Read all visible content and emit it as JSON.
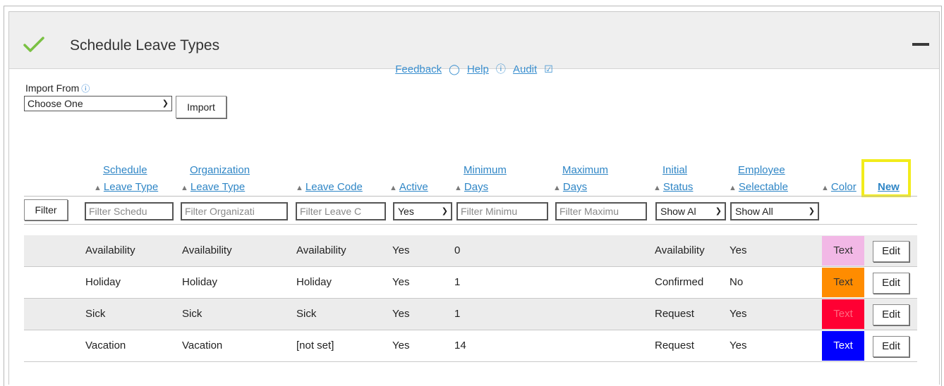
{
  "panel": {
    "title": "Schedule Leave Types"
  },
  "links": {
    "feedback": "Feedback",
    "help": "Help",
    "audit": "Audit"
  },
  "import": {
    "label": "Import From",
    "select_value": "Choose One",
    "button": "Import"
  },
  "columns": {
    "schedule_leave_type": [
      "Schedule",
      "Leave Type"
    ],
    "organization_leave_type": [
      "Organization",
      "Leave Type"
    ],
    "leave_code": "Leave Code",
    "active": "Active",
    "minimum_days": [
      "Minimum",
      "Days"
    ],
    "maximum_days": [
      "Maximum",
      "Days"
    ],
    "initial_status": [
      "Initial",
      "Status"
    ],
    "employee_selectable": [
      "Employee",
      "Selectable"
    ],
    "color": "Color",
    "new": "New"
  },
  "filters": {
    "button": "Filter",
    "schedule_placeholder": "Filter Schedu",
    "organization_placeholder": "Filter Organizati",
    "leave_code_placeholder": "Filter Leave C",
    "active_value": "Yes",
    "minimum_placeholder": "Filter Minimu",
    "maximum_placeholder": "Filter Maximu",
    "status_value": "Show Al",
    "selectable_value": "Show All"
  },
  "rows": [
    {
      "schedule": "Availability",
      "organization": "Availability",
      "code": "Availability",
      "active": "Yes",
      "min": "0",
      "max": "",
      "status": "Availability",
      "selectable": "Yes",
      "color_text": "Text",
      "color_bg": "#f2b8e6",
      "color_fg": "#333333",
      "edit": "Edit"
    },
    {
      "schedule": "Holiday",
      "organization": "Holiday",
      "code": "Holiday",
      "active": "Yes",
      "min": "1",
      "max": "",
      "status": "Confirmed",
      "selectable": "No",
      "color_text": "Text",
      "color_bg": "#ff8c00",
      "color_fg": "#333333",
      "edit": "Edit"
    },
    {
      "schedule": "Sick",
      "organization": "Sick",
      "code": "Sick",
      "active": "Yes",
      "min": "1",
      "max": "",
      "status": "Request",
      "selectable": "Yes",
      "color_text": "Text",
      "color_bg": "#ff0033",
      "color_fg": "#ff6a80",
      "edit": "Edit"
    },
    {
      "schedule": "Vacation",
      "organization": "Vacation",
      "code": "[not set]",
      "active": "Yes",
      "min": "14",
      "max": "",
      "status": "Request",
      "selectable": "Yes",
      "color_text": "Text",
      "color_bg": "#0000ff",
      "color_fg": "#ffffff",
      "edit": "Edit"
    }
  ],
  "colors": {
    "accent_link": "#2f86c6",
    "check": "#7ac143",
    "highlight": "#f2ec1b"
  }
}
